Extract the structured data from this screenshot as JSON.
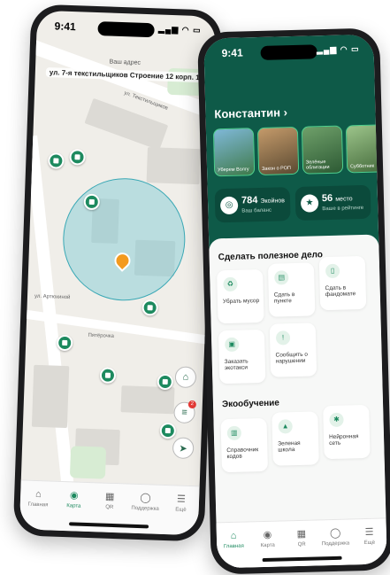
{
  "map_screen": {
    "status_time": "9:41",
    "address_caption": "Ваш адрес",
    "address": "ул. 7-я текстильщиков Строение 12 корп. 1",
    "street_label_1": "ул. Текстильщиков",
    "street_label_2": "ул. Артюхиной",
    "place_label": "Пятёрочка",
    "filter_badge": "2",
    "tabs": [
      {
        "label": "Главная",
        "icon": "home-icon"
      },
      {
        "label": "Карта",
        "icon": "map-pin-icon",
        "active": true
      },
      {
        "label": "QR",
        "icon": "qr-icon"
      },
      {
        "label": "Поддержка",
        "icon": "chat-icon"
      },
      {
        "label": "Ещё",
        "icon": "menu-icon"
      }
    ]
  },
  "home_screen": {
    "status_time": "9:41",
    "user_name": "Константин",
    "stories": [
      {
        "label": "Уберем Волгу"
      },
      {
        "label": "Закон о РОП"
      },
      {
        "label": "Зелёные облигации"
      },
      {
        "label": "Субботник"
      }
    ],
    "balance": {
      "value": "784",
      "unit": "Экойнов",
      "caption": "Ваш баланс"
    },
    "rating": {
      "value": "56",
      "unit": "место",
      "caption": "Ваше в рейтинге"
    },
    "useful_section": {
      "title": "Сделать полезное дело",
      "cards": [
        {
          "label": "Убрать мусор"
        },
        {
          "label": "Сдать в пункте"
        },
        {
          "label": "Сдать в фандомате"
        },
        {
          "label": "Заказать экотакси"
        },
        {
          "label": "Сообщить о нарушении"
        }
      ]
    },
    "learning_section": {
      "title": "Экообучение",
      "cards": [
        {
          "label": "Справочник кодов"
        },
        {
          "label": "Зеленая школа"
        },
        {
          "label": "Нейронная сеть"
        }
      ]
    },
    "tabs": [
      {
        "label": "Главная",
        "icon": "home-icon",
        "active": true
      },
      {
        "label": "Карта",
        "icon": "map-pin-icon"
      },
      {
        "label": "QR",
        "icon": "qr-icon"
      },
      {
        "label": "Поддержка",
        "icon": "chat-icon"
      },
      {
        "label": "Ещё",
        "icon": "menu-icon"
      }
    ]
  },
  "colors": {
    "brand_green": "#0e5a48",
    "accent_green": "#1d8a5f",
    "pin_orange": "#f39a1e",
    "badge_red": "#e53935"
  }
}
